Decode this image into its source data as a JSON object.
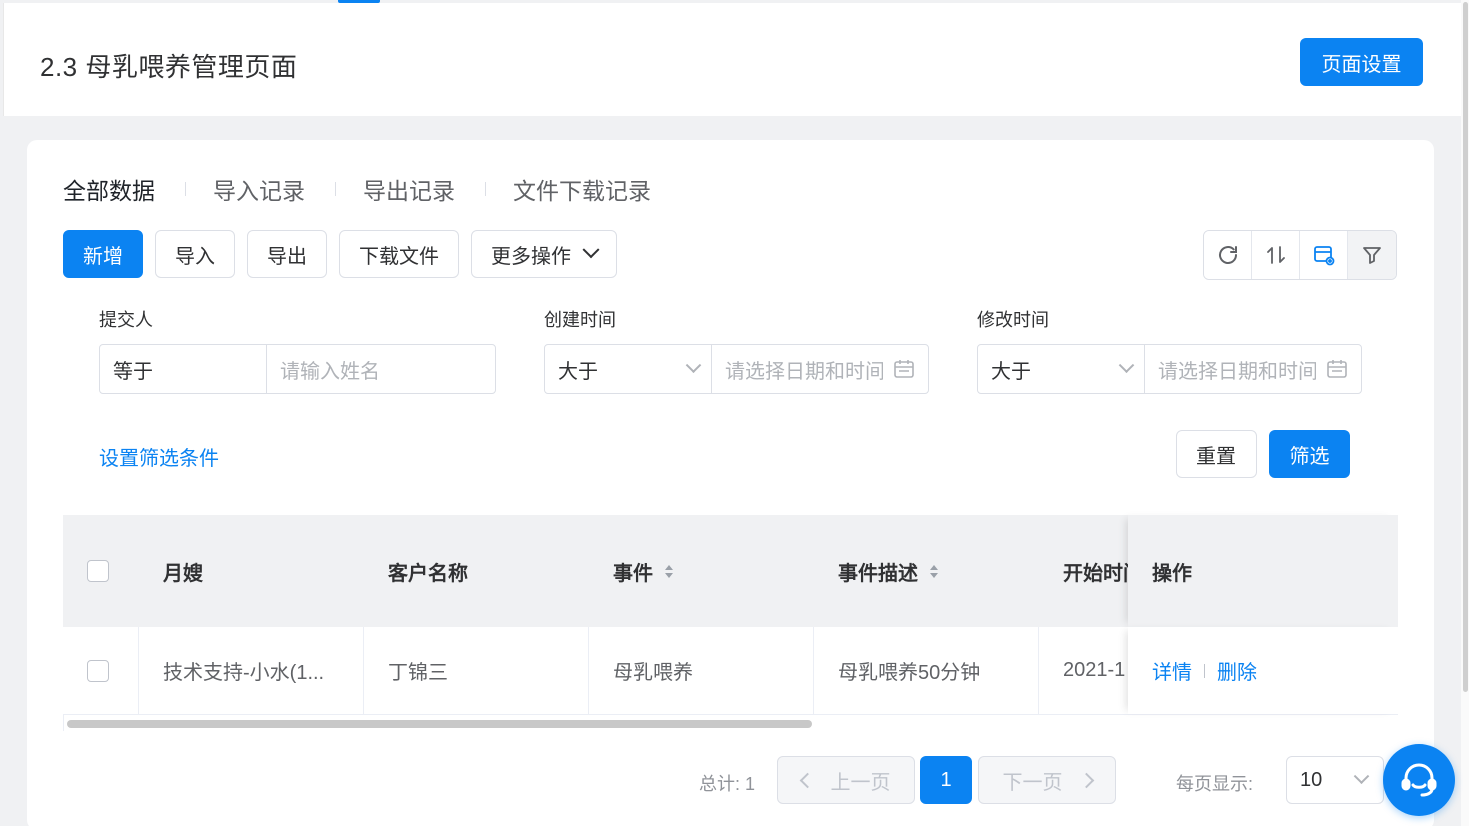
{
  "header": {
    "title": "2.3 母乳喂养管理页面",
    "settings_button": "页面设置"
  },
  "tabs": [
    "全部数据",
    "导入记录",
    "导出记录",
    "文件下载记录"
  ],
  "toolbar": {
    "add": "新增",
    "import": "导入",
    "export": "导出",
    "download": "下载文件",
    "more": "更多操作"
  },
  "toolbar_icons": [
    "refresh-icon",
    "sort-icon",
    "column-settings-icon",
    "filter-icon"
  ],
  "filters": [
    {
      "label": "提交人",
      "operator": "等于",
      "placeholder": "请输入姓名"
    },
    {
      "label": "创建时间",
      "operator": "大于",
      "placeholder": "请选择日期和时间"
    },
    {
      "label": "修改时间",
      "operator": "大于",
      "placeholder": "请选择日期和时间"
    }
  ],
  "filter_actions": {
    "set_conditions": "设置筛选条件",
    "reset": "重置",
    "apply": "筛选"
  },
  "table": {
    "columns": [
      "月嫂",
      "客户名称",
      "事件",
      "事件描述",
      "开始时间",
      "操作"
    ],
    "rows": [
      {
        "nanny": "技术支持-小水(1...",
        "customer": "丁锦三",
        "event": "母乳喂养",
        "description": "母乳喂养50分钟",
        "start": "2021-1",
        "actions": [
          "详情",
          "删除"
        ]
      }
    ]
  },
  "pagination": {
    "total": "总计: 1",
    "prev": "上一页",
    "current": "1",
    "next": "下一页",
    "page_size_label": "每页显示:",
    "page_size": "10"
  },
  "colors": {
    "primary": "#0b83f2",
    "background": "#f0f1f3"
  }
}
